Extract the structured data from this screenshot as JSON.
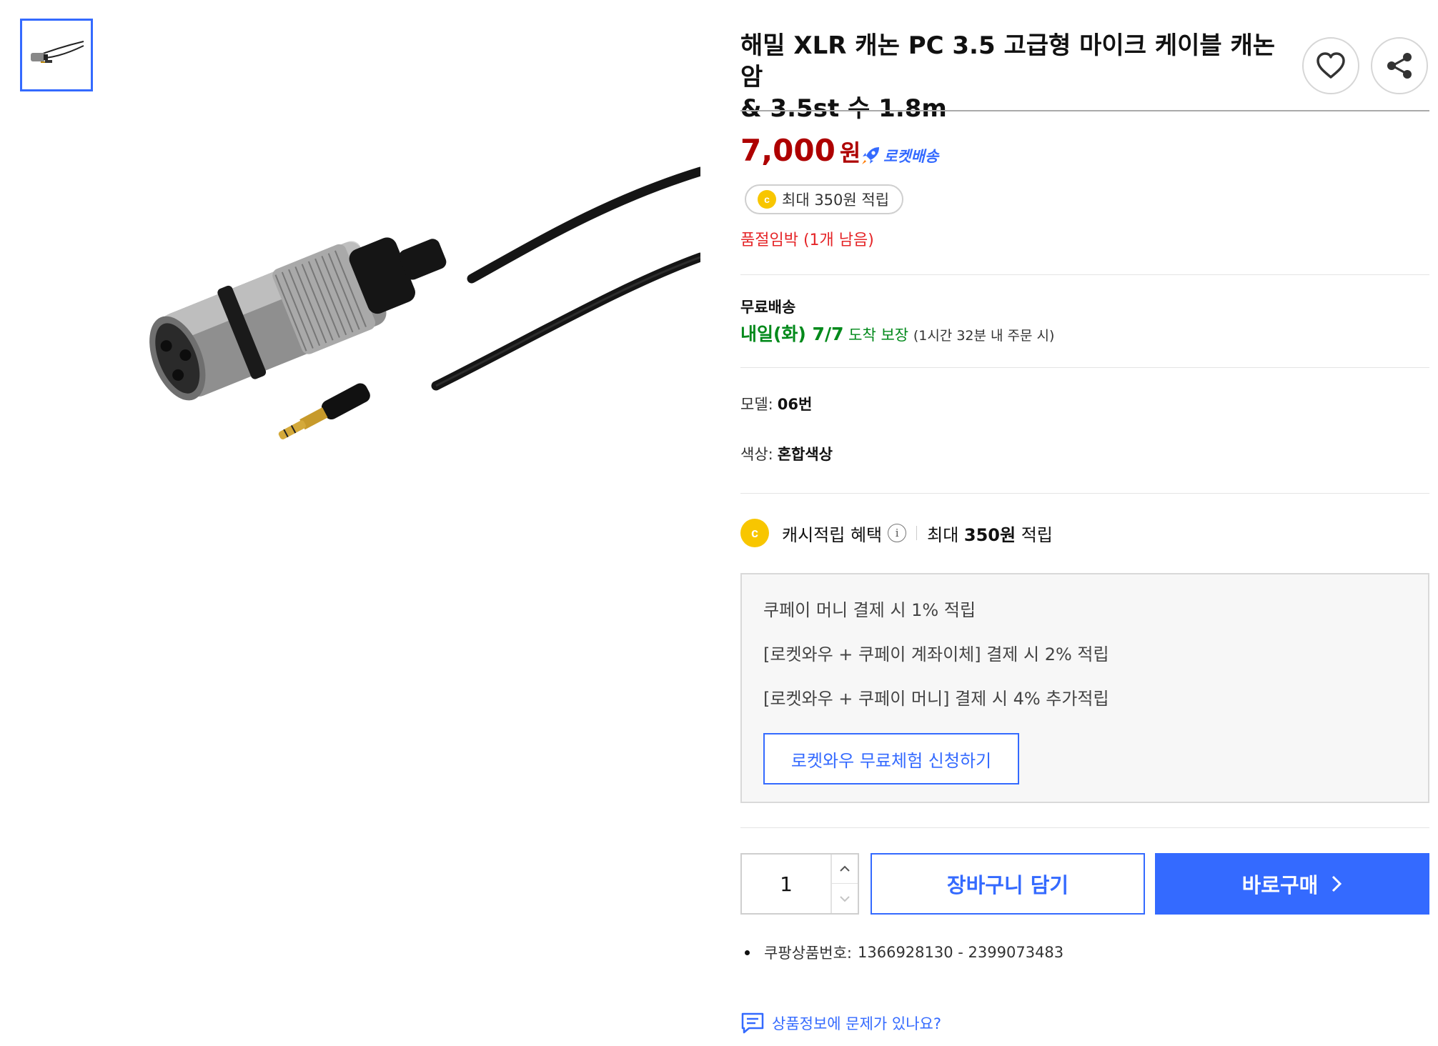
{
  "product": {
    "title_line1": "해밀 XLR 캐논 PC 3.5 고급형 마이크 케이블 캐논 암",
    "title_line2": "& 3.5st 수 1.8m",
    "price_amount": "7,000",
    "price_unit": "원",
    "rocket_label": "로켓배송",
    "cash_pill": "최대 350원 적립",
    "coin_letter": "c",
    "stock_notice": "품절임박 (1개 남음)",
    "model_label": "모델:",
    "model_value": "06번",
    "color_label": "색상:",
    "color_value": "혼합색상",
    "product_number_label": "쿠팡상품번호:",
    "product_number_value": "1366928130 - 2399073483"
  },
  "shipping": {
    "title": "무료배송",
    "arrival_date": "내일(화) 7/7",
    "arrival_guarantee": "도착 보장",
    "arrival_condition": "(1시간 32분 내 주문 시)"
  },
  "benefit": {
    "label": "캐시적립 혜택",
    "info": "i",
    "max_prefix": "최대 ",
    "max_amount": "350원",
    "max_suffix": " 적립"
  },
  "payment_box": {
    "lines": [
      "쿠페이 머니 결제 시 1% 적립",
      "[로켓와우 + 쿠페이 계좌이체] 결제 시 2% 적립",
      "[로켓와우 + 쿠페이 머니] 결제 시 4% 추가적립"
    ],
    "trial_button": "로켓와우 무료체험 신청하기"
  },
  "purchase": {
    "quantity": "1",
    "cart_button": "장바구니 담기",
    "buy_button": "바로구매"
  },
  "report_link": "상품정보에 문제가 있나요?",
  "icons": {
    "wishlist": "heart-icon",
    "share": "share-icon",
    "rocket": "rocket-icon",
    "qty_up": "chevron-up-icon",
    "qty_down": "chevron-down-icon",
    "buy_arrow": "chevron-right-icon",
    "report": "chat-icon"
  },
  "colors": {
    "accent": "#346aff",
    "price": "#ae0000",
    "stock": "#e52528",
    "arrival": "#00891a",
    "coin": "#f8c600"
  }
}
